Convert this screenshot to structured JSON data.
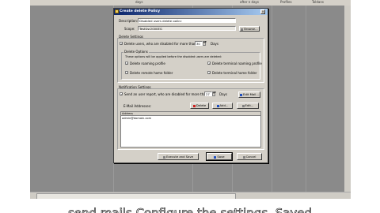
{
  "background_window": {
    "columns": [
      "days",
      "Profiles",
      "after n days",
      "Profiles",
      "Toldans"
    ]
  },
  "dialog": {
    "title": "Create delete Policy",
    "description_label": "Description:",
    "description_value": "Disabled users delete policy",
    "scope_label": "Scope:",
    "scope_value": "TestUsr2000EG",
    "browse_label": "Browse...",
    "delete_settings": {
      "group_title": "Delete Settings",
      "delete_users_label": "Delete users, who are disabled for more than",
      "delete_users_days": "30",
      "days_label": "Days",
      "delete_options_title": "Delete Options",
      "delete_options_desc": "These options will be applied before the disabled users are deleted:",
      "delete_roaming_profile": "Delete roaming profile",
      "delete_terminal_roaming_profile": "Delete terminal roaming profile",
      "delete_remote_home_folder": "Delete remote home folder",
      "delete_terminal_home_folder": "Delete terminal home folder"
    },
    "notification_settings": {
      "group_title": "Notification Settings",
      "send_report_label": "Send an user report, who are disabled for more than",
      "send_report_days": "27",
      "days_label": "Days",
      "edit_mail_label": "Edit Mail...",
      "email_addresses_label": "E-Mail Addresses:",
      "delete_label": "Delete",
      "add_label": "Add...",
      "edit_label": "Edit...",
      "address_column": "Address",
      "addresses": [
        "admin@domain.com"
      ]
    },
    "execute_save_label": "Execute and Save",
    "save_label": "Save",
    "cancel_label": "Cancel"
  },
  "caption": "send mails Configure the settings, Saved"
}
